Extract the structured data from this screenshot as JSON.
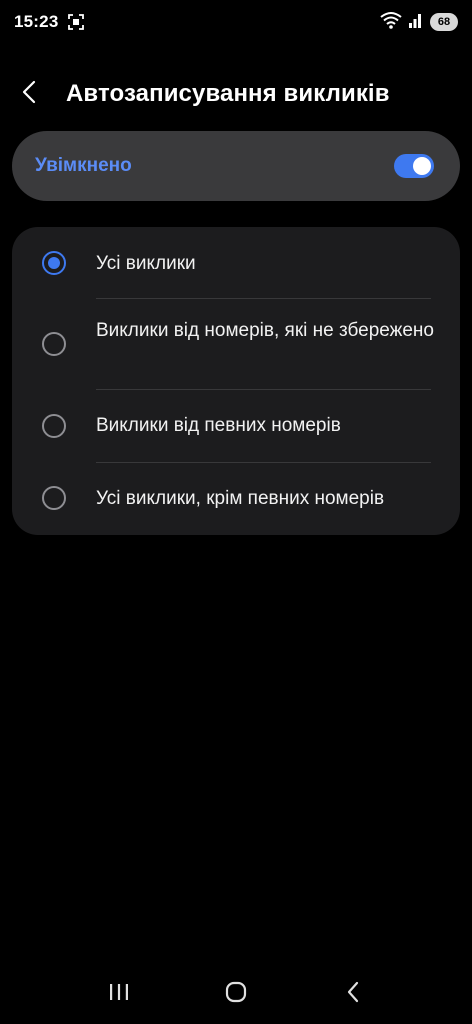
{
  "status_bar": {
    "time": "15:23",
    "battery": "68",
    "icons": [
      "screen-record-icon",
      "wifi-icon",
      "signal-icon",
      "battery-icon"
    ]
  },
  "header": {
    "back_icon": "chevron-left-icon",
    "title": "Автозаписування викликів"
  },
  "master": {
    "label": "Увімкнено",
    "enabled": true
  },
  "options": [
    {
      "label": "Усі виклики",
      "selected": true
    },
    {
      "label": "Виклики від номерів, які не збережено",
      "selected": false
    },
    {
      "label": "Виклики від певних номерів",
      "selected": false
    },
    {
      "label": "Усі виклики, крім певних номерів",
      "selected": false
    }
  ],
  "nav_bar": {
    "icons": [
      "recent-apps-icon",
      "home-icon",
      "back-icon"
    ]
  },
  "colors": {
    "accent": "#3e79f0",
    "accent_text": "#5b8cf6",
    "card": "#1c1c1e",
    "toggle_card": "#3a3a3c",
    "background": "#000000"
  }
}
